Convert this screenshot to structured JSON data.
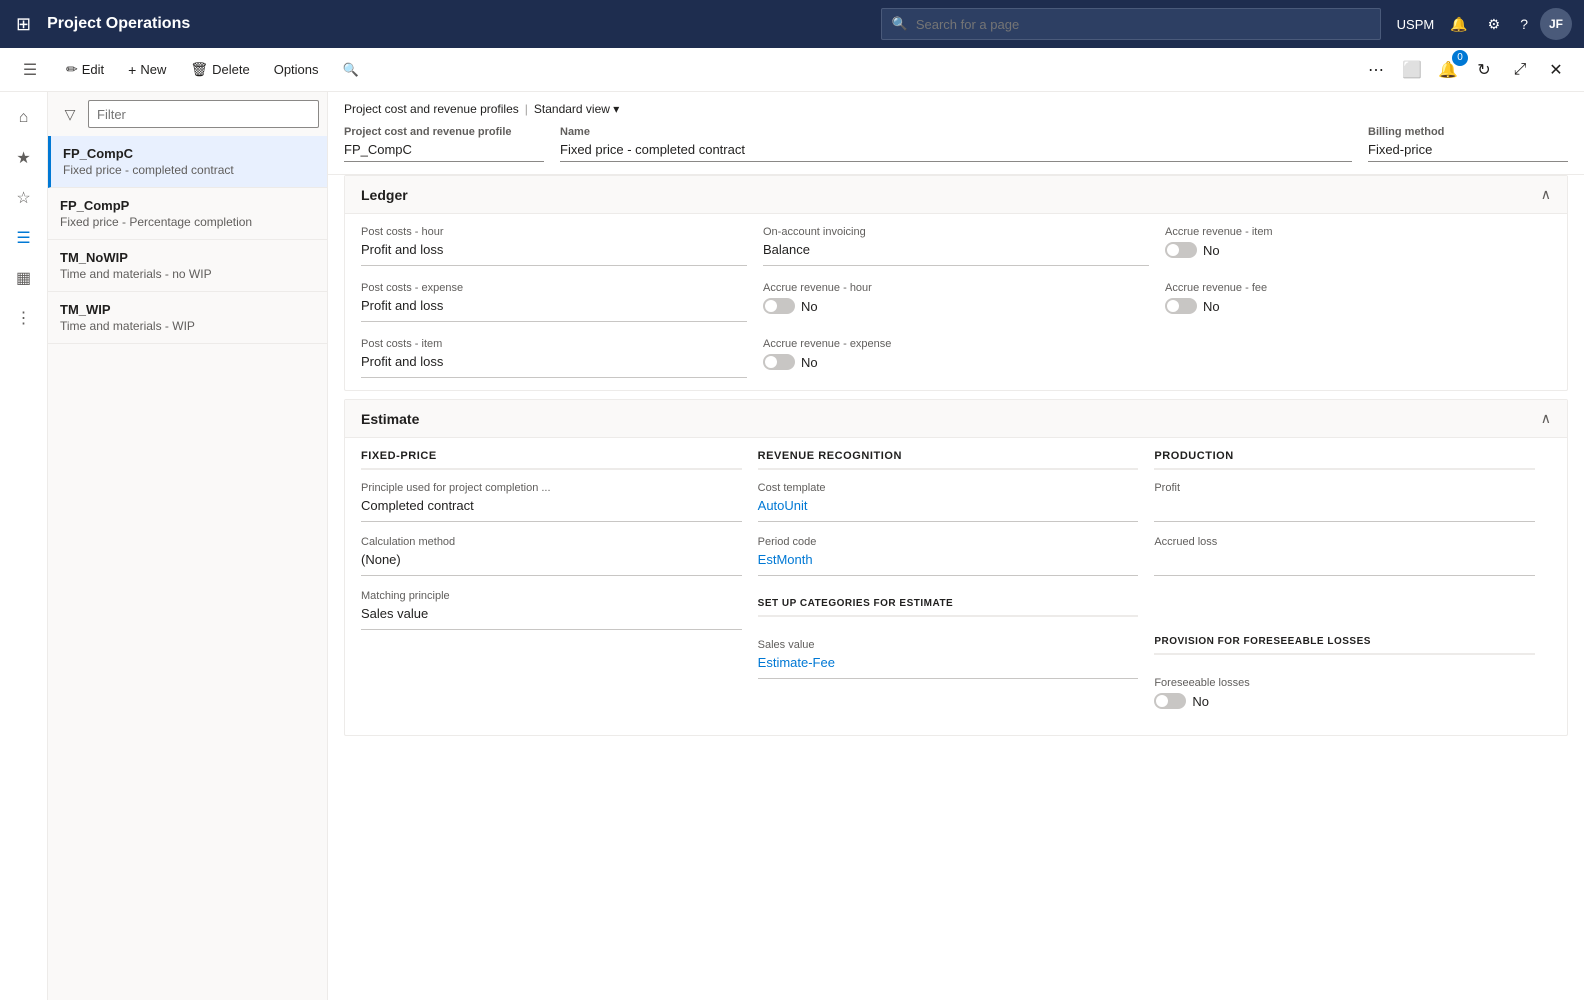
{
  "topNav": {
    "appName": "Project Operations",
    "searchPlaceholder": "Search for a page",
    "userInitials": "JF",
    "userName": "USPM"
  },
  "commandBar": {
    "editLabel": "Edit",
    "newLabel": "New",
    "deleteLabel": "Delete",
    "optionsLabel": "Options"
  },
  "listPanel": {
    "filterPlaceholder": "Filter",
    "items": [
      {
        "id": "FP_CompC",
        "title": "FP_CompC",
        "subtitle": "Fixed price - completed contract",
        "selected": true
      },
      {
        "id": "FP_CompP",
        "title": "FP_CompP",
        "subtitle": "Fixed price - Percentage completion",
        "selected": false
      },
      {
        "id": "TM_NoWIP",
        "title": "TM_NoWIP",
        "subtitle": "Time and materials - no WIP",
        "selected": false
      },
      {
        "id": "TM_WIP",
        "title": "TM_WIP",
        "subtitle": "Time and materials - WIP",
        "selected": false
      }
    ]
  },
  "breadcrumb": {
    "parent": "Project cost and revenue profiles",
    "current": "Project cost and revenue profile",
    "viewLabel": "Standard view",
    "separator": "|"
  },
  "recordHeader": {
    "profileLabel": "Project cost and revenue profile",
    "profileValue": "FP_CompC",
    "nameLabel": "Name",
    "nameValue": "Fixed price - completed contract",
    "billingLabel": "Billing method",
    "billingValue": "Fixed-price"
  },
  "ledgerSection": {
    "title": "Ledger",
    "postCostsHourLabel": "Post costs - hour",
    "postCostsHourValue": "Profit and loss",
    "onAccountInvoicingLabel": "On-account invoicing",
    "onAccountInvoicingValue": "Balance",
    "accrueRevenueItemLabel": "Accrue revenue - item",
    "accrueRevenueItemToggle": false,
    "accrueRevenueItemValue": "No",
    "postCostsExpenseLabel": "Post costs - expense",
    "postCostsExpenseValue": "Profit and loss",
    "accrueRevenueHourLabel": "Accrue revenue - hour",
    "accrueRevenueHourToggle": false,
    "accrueRevenueHourValue": "No",
    "accrueRevenueFeeLabel": "Accrue revenue - fee",
    "accrueRevenueFeeToggle": false,
    "accrueRevenueFeeValue": "No",
    "postCostsItemLabel": "Post costs - item",
    "postCostsItemValue": "Profit and loss",
    "accrueRevenueExpenseLabel": "Accrue revenue - expense",
    "accrueRevenueExpenseToggle": false,
    "accrueRevenueExpenseValue": "No"
  },
  "estimateSection": {
    "title": "Estimate",
    "fixedPriceHeader": "FIXED-PRICE",
    "revenueRecognitionHeader": "REVENUE RECOGNITION",
    "productionHeader": "Production",
    "principleLabel": "Principle used for project completion ...",
    "principleValue": "Completed contract",
    "costTemplateLabel": "Cost template",
    "costTemplateValue": "AutoUnit",
    "profitLabel": "Profit",
    "profitValue": "",
    "calcMethodLabel": "Calculation method",
    "calcMethodValue": "(None)",
    "periodCodeLabel": "Period code",
    "periodCodeValue": "EstMonth",
    "accruedLossLabel": "Accrued loss",
    "accruedLossValue": "",
    "matchingPrincipleLabel": "Matching principle",
    "matchingPrincipleValue": "Sales value",
    "setupCategoriesHeader": "SET UP CATEGORIES FOR ESTIMATE",
    "salesValueLabel": "Sales value",
    "salesValueValue": "Estimate-Fee",
    "provisionHeader": "PROVISION FOR FORESEEABLE LOSSES",
    "foreseeableLossesLabel": "Foreseeable losses",
    "foreseeableLossesToggle": false,
    "foreseeableLossesValue": "No"
  }
}
